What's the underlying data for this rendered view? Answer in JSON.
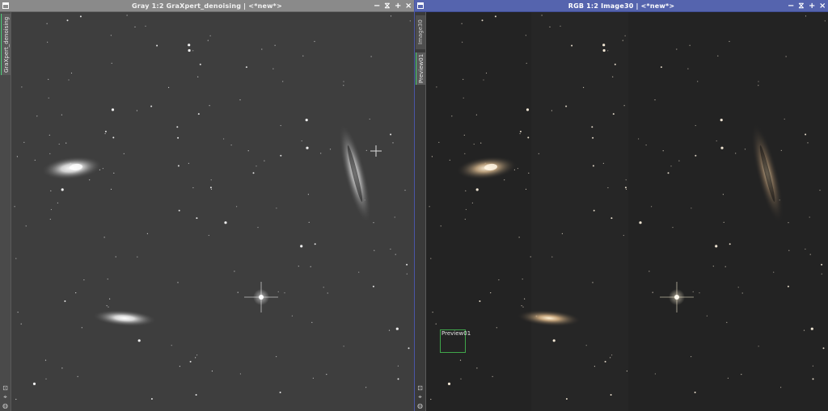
{
  "left_window": {
    "title": "Gray 1:2 GraXpert_denoising | <*new*>",
    "tab_label": "GraXpert_denoising",
    "buttons": [
      "−",
      "⧖",
      "+",
      "×"
    ]
  },
  "right_window": {
    "title": "RGB 1:2 Image30 | <*new*>",
    "tabs": [
      "Image30",
      "Preview01"
    ],
    "buttons": [
      "−",
      "⧖",
      "+",
      "×"
    ],
    "preview_label": "Preview01"
  },
  "icons": {
    "window_icon": "window-icon",
    "minimize": "minimize-icon",
    "shade": "shade-icon",
    "maximize": "maximize-icon",
    "close": "close-icon",
    "crosshair": "crosshair-cursor-icon"
  },
  "colors": {
    "left_title_bg": "#8a8a8a",
    "right_title_bg": "#5564ae",
    "left_sky": "#3b3b3b",
    "right_sky": "#232323",
    "preview_border": "#3fa64a",
    "active_tab_marker": "#4ad27a"
  }
}
